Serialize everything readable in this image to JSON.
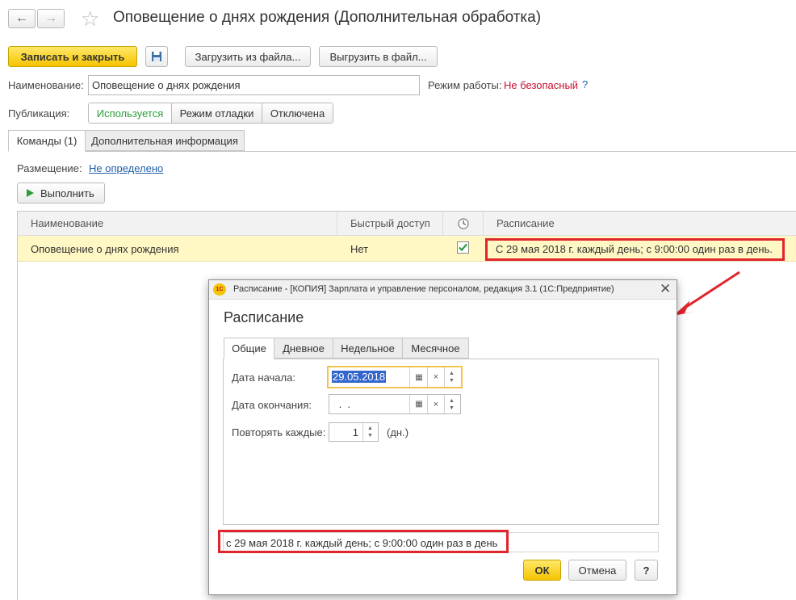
{
  "window": {
    "title": "Оповещение о днях рождения (Дополнительная обработка)",
    "nav_back": "←",
    "nav_forward": "→",
    "favorite_icon": "☆"
  },
  "toolbar": {
    "save_close": "Записать и закрыть",
    "load_from_file": "Загрузить из файла...",
    "export_to_file": "Выгрузить в файл..."
  },
  "form": {
    "name_label": "Наименование:",
    "name_value": "Оповещение о днях рождения",
    "mode_label": "Режим работы:",
    "mode_value": "Не безопасный",
    "mode_help": "?",
    "publication_label": "Публикация:",
    "publication_options": [
      "Используется",
      "Режим отладки",
      "Отключена"
    ]
  },
  "tabs": [
    "Команды (1)",
    "Дополнительная информация"
  ],
  "placement": {
    "label": "Размещение:",
    "value": "Не определено"
  },
  "execute_button": "Выполнить",
  "commands_table": {
    "columns": [
      "Наименование",
      "Быстрый доступ",
      "",
      "Расписание"
    ],
    "rows": [
      {
        "name": "Оповещение о днях рождения",
        "quick_access": "Нет",
        "scheduled": true,
        "schedule": "С 29 мая 2018 г. каждый день; с 9:00:00 один раз в день."
      }
    ]
  },
  "dialog": {
    "title": "Расписание - [КОПИЯ] Зарплата и управление персоналом, редакция 3.1  (1С:Предприятие)",
    "logo": "1С",
    "heading": "Расписание",
    "tabs": [
      "Общие",
      "Дневное",
      "Недельное",
      "Месячное"
    ],
    "start_date_label": "Дата начала:",
    "start_date_value": "29.05.2018",
    "end_date_label": "Дата окончания:",
    "end_date_value": " .  .",
    "repeat_label": "Повторять каждые:",
    "repeat_value": "1",
    "repeat_unit": "(дн.)",
    "summary": "с 29 мая 2018 г. каждый день; с 9:00:00 один раз в день",
    "ok": "ОК",
    "cancel": "Отмена",
    "help": "?"
  },
  "colors": {
    "accent_yellow": "#f5c400",
    "highlight_red": "#e0262c",
    "mode_red": "#c8102e",
    "link_blue": "#1f5fa8",
    "active_green": "#2a9d3a",
    "row_selected": "#fff8c4"
  }
}
